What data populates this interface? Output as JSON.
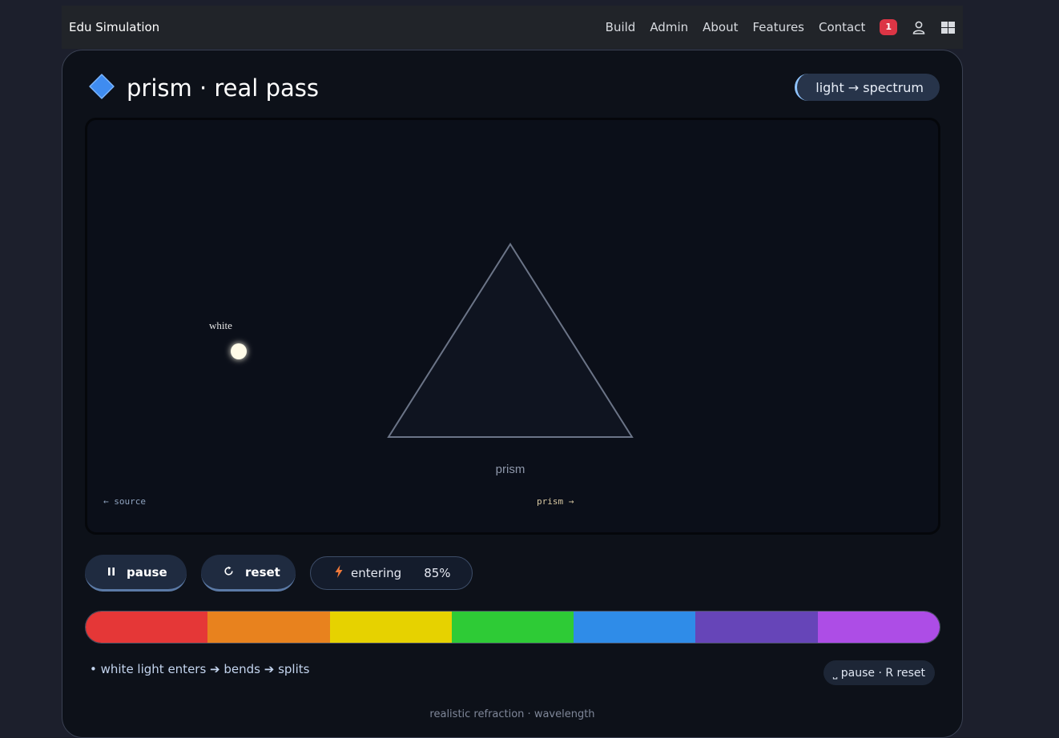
{
  "navbar": {
    "brand": "Edu Simulation",
    "links": [
      "Build",
      "Admin",
      "About",
      "Features",
      "Contact"
    ],
    "notification_count": "1",
    "icons": [
      "user-icon",
      "windows-icon"
    ]
  },
  "card": {
    "title_icon": "blue-diamond-icon",
    "title": "prism · real pass",
    "tag": "light → spectrum"
  },
  "stage": {
    "beam_label": "white",
    "prism_label": "prism",
    "left_hint": "← source",
    "right_hint": "prism →"
  },
  "controls": {
    "pause_label": "pause",
    "reset_label": "reset",
    "status_label": "entering",
    "status_percent": "85%"
  },
  "spectrum_colors": [
    "#e53737",
    "#e8821e",
    "#e6d200",
    "#2ecb36",
    "#2f8ce8",
    "#6645b8",
    "#ad4de6"
  ],
  "caption": "• white light enters ➔ bends ➔ splits",
  "hint": "⎵ pause · R reset",
  "footer": "realistic refraction · wavelength"
}
